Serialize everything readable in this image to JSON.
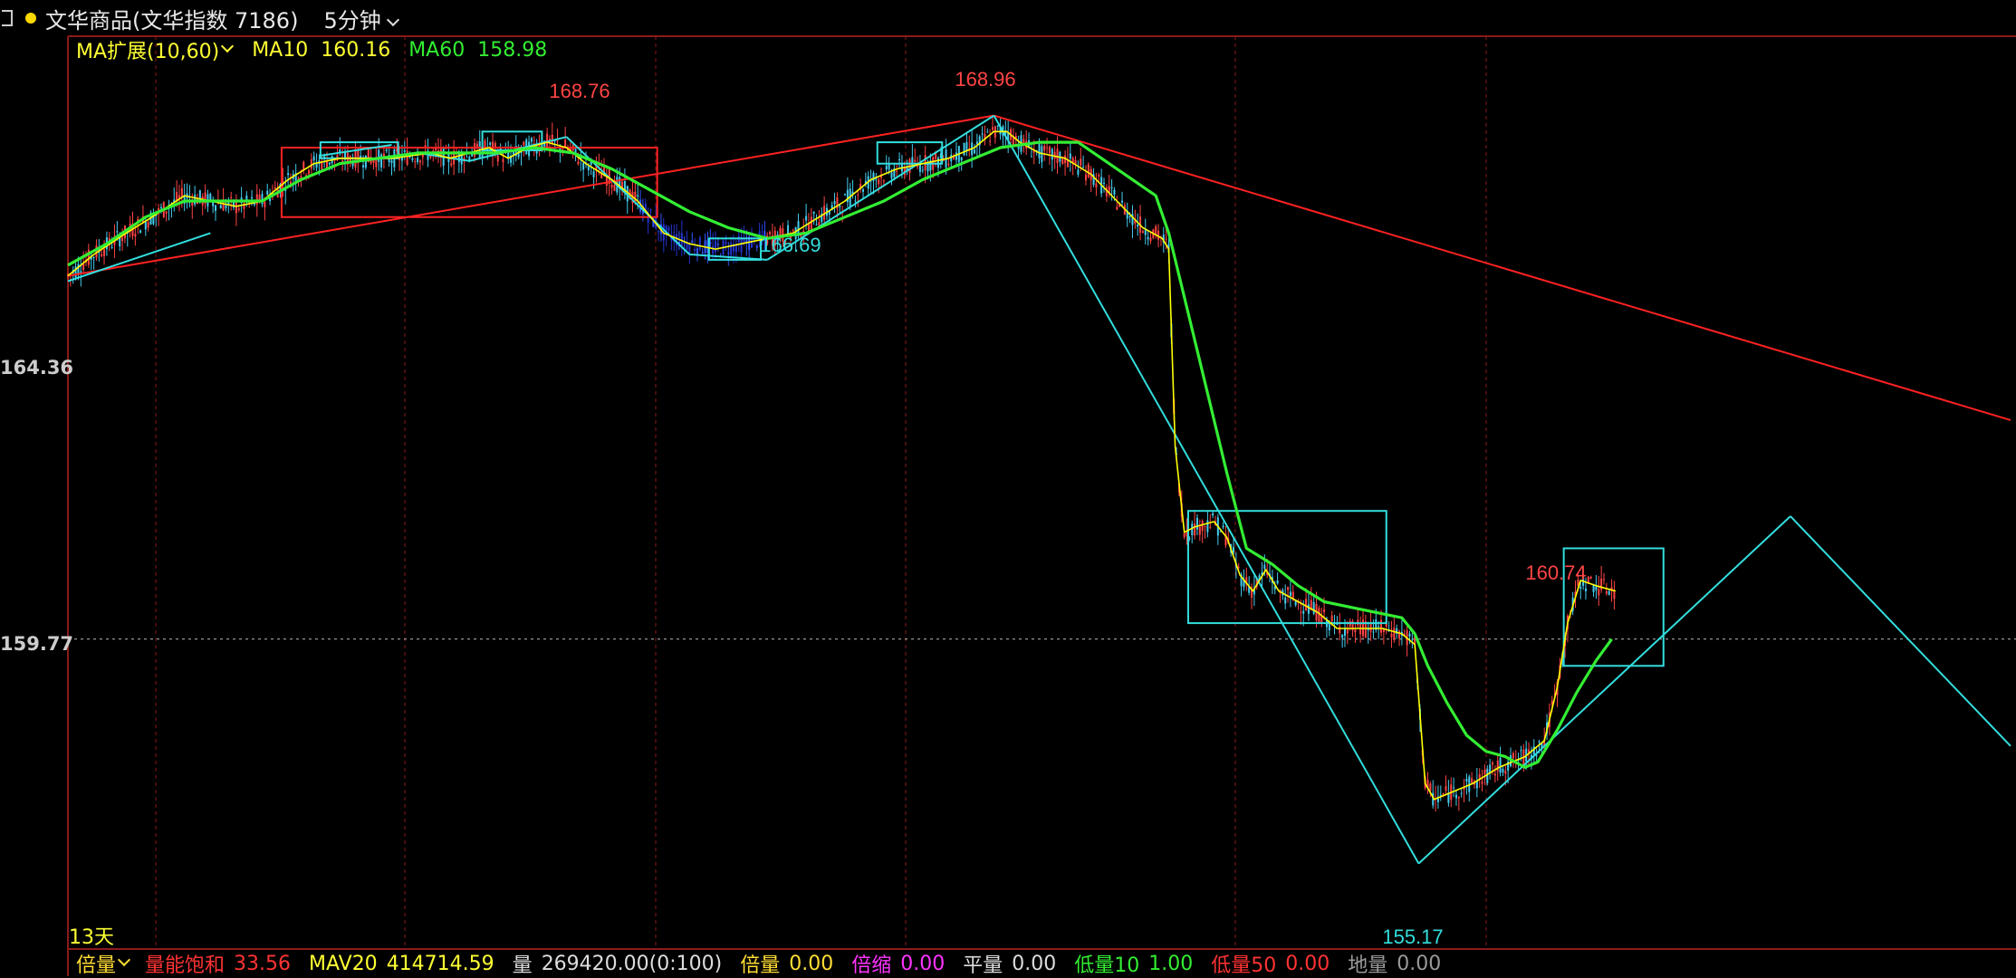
{
  "header": {
    "title": "文华商品(文华指数 7186)",
    "period": "5分钟"
  },
  "indicator": {
    "name": "MA扩展(10,60)",
    "ma10_label": "MA10",
    "ma10_value": "160.16",
    "ma60_label": "MA60",
    "ma60_value": "158.98"
  },
  "axis": {
    "y_label_1": "164.36",
    "y_label_2": "159.77"
  },
  "days_label": "13天",
  "annotations": {
    "high1": "168.76",
    "high2": "168.96",
    "low1": "166.69",
    "high3": "160.74",
    "low2": "155.17"
  },
  "bottom_bar": {
    "multiple_label": "倍量",
    "vol_sat_label": "量能饱和",
    "vol_sat_value": "33.56",
    "mav20_label": "MAV20",
    "mav20_value": "414714.59",
    "vol_label": "量",
    "vol_value": "269420.00(0:100)",
    "bei_label": "倍量",
    "bei_value": "0.00",
    "shrink_label": "倍缩",
    "shrink_value": "0.00",
    "flat_label": "平量",
    "flat_value": "0.00",
    "low10_label": "低量10",
    "low10_value": "1.00",
    "low50_label": "低量50",
    "low50_value": "0.00",
    "ground_label": "地量",
    "ground_value": "0.00"
  },
  "colors": {
    "background": "#000000",
    "ma10": "#ffff00",
    "ma60": "#33ee33",
    "trend_red": "#ff2222",
    "trend_cyan": "#33dddd",
    "grid": "#8b1a1a"
  },
  "chart_data": {
    "type": "line",
    "ylim": [
      153.6,
      170.6
    ],
    "ticks_y": [
      164.36,
      159.77
    ],
    "reference_line": 159.4,
    "series": [
      {
        "name": "MA10",
        "points": [
          [
            0,
            166.2
          ],
          [
            20,
            166.6
          ],
          [
            45,
            167.0
          ],
          [
            65,
            167.3
          ],
          [
            90,
            167.7
          ],
          [
            110,
            167.6
          ],
          [
            130,
            167.5
          ],
          [
            150,
            167.6
          ],
          [
            170,
            168.0
          ],
          [
            190,
            168.3
          ],
          [
            210,
            168.4
          ],
          [
            230,
            168.4
          ],
          [
            250,
            168.4
          ],
          [
            265,
            168.45
          ],
          [
            280,
            168.5
          ],
          [
            295,
            168.4
          ],
          [
            310,
            168.5
          ],
          [
            325,
            168.6
          ],
          [
            340,
            168.4
          ],
          [
            355,
            168.6
          ],
          [
            370,
            168.7
          ],
          [
            385,
            168.6
          ],
          [
            400,
            168.3
          ],
          [
            420,
            168.0
          ],
          [
            440,
            167.6
          ],
          [
            460,
            167.0
          ],
          [
            480,
            166.8
          ],
          [
            500,
            166.7
          ],
          [
            520,
            166.8
          ],
          [
            540,
            166.9
          ],
          [
            560,
            167.0
          ],
          [
            580,
            167.3
          ],
          [
            600,
            167.6
          ],
          [
            620,
            168.0
          ],
          [
            640,
            168.2
          ],
          [
            660,
            168.3
          ],
          [
            680,
            168.4
          ],
          [
            700,
            168.6
          ],
          [
            715,
            168.9
          ],
          [
            725,
            168.9
          ],
          [
            735,
            168.7
          ],
          [
            750,
            168.5
          ],
          [
            770,
            168.4
          ],
          [
            790,
            168.1
          ],
          [
            810,
            167.6
          ],
          [
            830,
            167.1
          ],
          [
            845,
            166.9
          ],
          [
            850,
            166.7
          ],
          [
            855,
            163.0
          ],
          [
            862,
            161.4
          ],
          [
            870,
            161.5
          ],
          [
            885,
            161.6
          ],
          [
            895,
            161.3
          ],
          [
            905,
            160.6
          ],
          [
            915,
            160.3
          ],
          [
            925,
            160.7
          ],
          [
            935,
            160.3
          ],
          [
            950,
            160.1
          ],
          [
            965,
            159.9
          ],
          [
            980,
            159.6
          ],
          [
            995,
            159.6
          ],
          [
            1015,
            159.6
          ],
          [
            1030,
            159.5
          ],
          [
            1040,
            159.3
          ],
          [
            1048,
            156.7
          ],
          [
            1055,
            156.4
          ],
          [
            1065,
            156.5
          ],
          [
            1085,
            156.7
          ],
          [
            1105,
            157.0
          ],
          [
            1125,
            157.2
          ],
          [
            1140,
            157.5
          ],
          [
            1150,
            158.5
          ],
          [
            1158,
            159.7
          ],
          [
            1168,
            160.5
          ],
          [
            1180,
            160.4
          ],
          [
            1195,
            160.3
          ]
        ]
      },
      {
        "name": "MA60",
        "points": [
          [
            0,
            166.4
          ],
          [
            30,
            166.8
          ],
          [
            60,
            167.3
          ],
          [
            90,
            167.6
          ],
          [
            120,
            167.6
          ],
          [
            150,
            167.6
          ],
          [
            180,
            168.0
          ],
          [
            210,
            168.3
          ],
          [
            240,
            168.4
          ],
          [
            270,
            168.5
          ],
          [
            300,
            168.5
          ],
          [
            330,
            168.5
          ],
          [
            360,
            168.6
          ],
          [
            390,
            168.5
          ],
          [
            420,
            168.2
          ],
          [
            450,
            167.8
          ],
          [
            480,
            167.4
          ],
          [
            510,
            167.1
          ],
          [
            540,
            166.9
          ],
          [
            570,
            167.0
          ],
          [
            600,
            167.3
          ],
          [
            630,
            167.6
          ],
          [
            660,
            168.0
          ],
          [
            690,
            168.3
          ],
          [
            720,
            168.6
          ],
          [
            750,
            168.7
          ],
          [
            780,
            168.7
          ],
          [
            810,
            168.2
          ],
          [
            840,
            167.7
          ],
          [
            850,
            167.0
          ],
          [
            865,
            165.5
          ],
          [
            880,
            164.0
          ],
          [
            895,
            162.5
          ],
          [
            910,
            161.1
          ],
          [
            930,
            160.8
          ],
          [
            950,
            160.4
          ],
          [
            970,
            160.1
          ],
          [
            990,
            160.0
          ],
          [
            1010,
            159.9
          ],
          [
            1030,
            159.8
          ],
          [
            1040,
            159.5
          ],
          [
            1050,
            158.9
          ],
          [
            1065,
            158.2
          ],
          [
            1080,
            157.6
          ],
          [
            1095,
            157.3
          ],
          [
            1110,
            157.2
          ],
          [
            1125,
            157.0
          ],
          [
            1135,
            157.1
          ],
          [
            1150,
            157.7
          ],
          [
            1165,
            158.4
          ],
          [
            1180,
            159.0
          ],
          [
            1192,
            159.4
          ]
        ]
      }
    ],
    "trend_lines": [
      {
        "color": "red",
        "from": [
          0,
          166.2
        ],
        "to": [
          715,
          169.2
        ]
      },
      {
        "color": "red",
        "from": [
          715,
          169.2
        ],
        "to": [
          1500,
          163.5
        ]
      },
      {
        "color": "cyan",
        "from": [
          0,
          166.1
        ],
        "to": [
          110,
          167.0
        ]
      },
      {
        "color": "cyan",
        "from": [
          195,
          168.45
        ],
        "to": [
          250,
          168.65
        ]
      },
      {
        "color": "cyan",
        "from": [
          270,
          168.5
        ],
        "to": [
          310,
          168.35
        ]
      },
      {
        "color": "cyan",
        "from": [
          310,
          168.35
        ],
        "to": [
          385,
          168.8
        ]
      },
      {
        "color": "cyan",
        "from": [
          385,
          168.8
        ],
        "to": [
          480,
          166.6
        ]
      },
      {
        "color": "cyan",
        "from": [
          480,
          166.6
        ],
        "to": [
          540,
          166.5
        ]
      },
      {
        "color": "cyan",
        "from": [
          540,
          166.5
        ],
        "to": [
          715,
          169.2
        ]
      },
      {
        "color": "cyan",
        "from": [
          715,
          169.2
        ],
        "to": [
          1043,
          155.2
        ]
      },
      {
        "color": "cyan",
        "from": [
          1043,
          155.2
        ],
        "to": [
          1330,
          161.7
        ]
      },
      {
        "color": "cyan",
        "from": [
          1330,
          161.7
        ],
        "to": [
          1500,
          157.4
        ]
      }
    ],
    "boxes": [
      {
        "color": "red",
        "x": [
          165,
          455
        ],
        "y": [
          167.3,
          168.6
        ]
      },
      {
        "color": "cyan",
        "x": [
          195,
          255
        ],
        "y": [
          168.4,
          168.7
        ]
      },
      {
        "color": "cyan",
        "x": [
          320,
          366
        ],
        "y": [
          168.55,
          168.9
        ]
      },
      {
        "color": "cyan",
        "x": [
          495,
          535
        ],
        "y": [
          166.5,
          166.9
        ]
      },
      {
        "color": "cyan",
        "x": [
          625,
          675
        ],
        "y": [
          168.3,
          168.7
        ]
      },
      {
        "color": "cyan",
        "x": [
          865,
          1018
        ],
        "y": [
          159.7,
          161.8
        ]
      },
      {
        "color": "cyan",
        "x": [
          1155,
          1232
        ],
        "y": [
          158.9,
          161.1
        ]
      }
    ]
  }
}
